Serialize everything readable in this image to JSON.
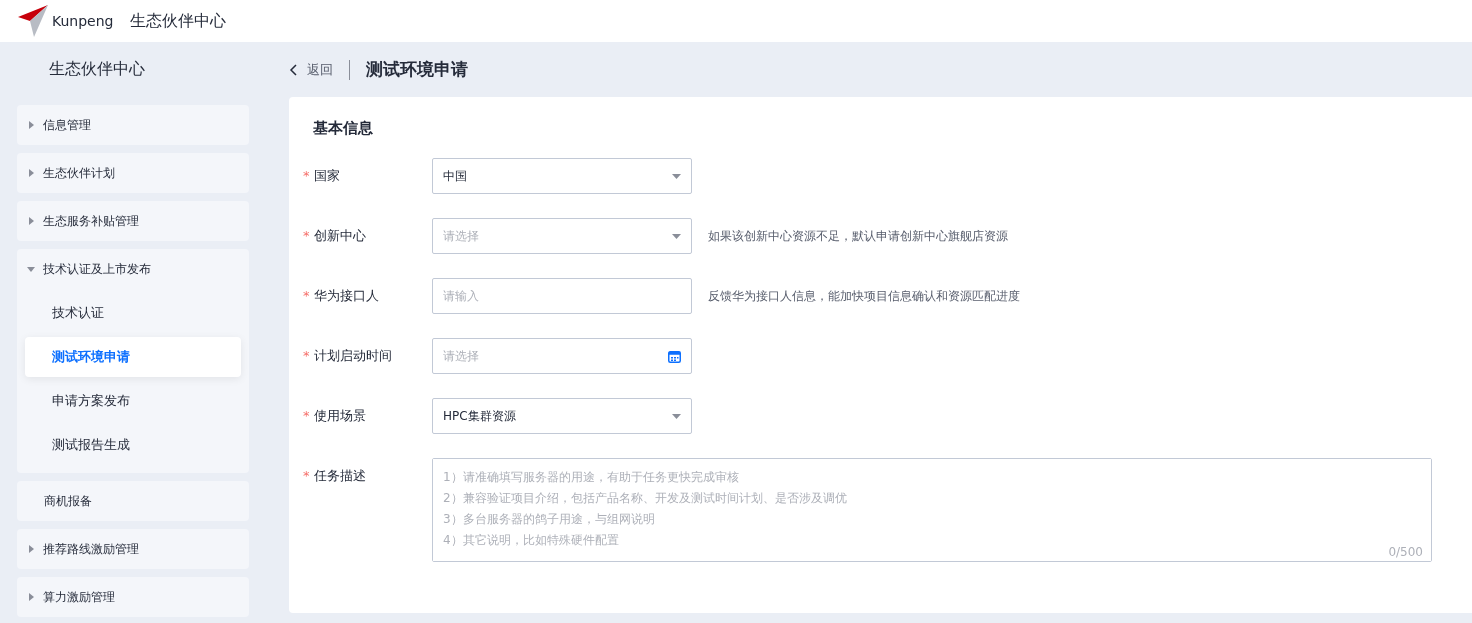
{
  "header": {
    "brand": "Kunpeng",
    "title": "生态伙伴中心"
  },
  "sidebar": {
    "title": "生态伙伴中心",
    "items": [
      {
        "kind": "group",
        "label": "信息管理",
        "expanded": false
      },
      {
        "kind": "group",
        "label": "生态伙伴计划",
        "expanded": false
      },
      {
        "kind": "group",
        "label": "生态服务补贴管理",
        "expanded": false
      },
      {
        "kind": "group",
        "label": "技术认证及上市发布",
        "expanded": true,
        "children": [
          {
            "label": "技术认证",
            "selected": false
          },
          {
            "label": "测试环境申请",
            "selected": true
          },
          {
            "label": "申请方案发布",
            "selected": false
          },
          {
            "label": "测试报告生成",
            "selected": false
          }
        ]
      },
      {
        "kind": "leaf",
        "label": "商机报备"
      },
      {
        "kind": "group",
        "label": "推荐路线激励管理",
        "expanded": false
      },
      {
        "kind": "group",
        "label": "算力激励管理",
        "expanded": false
      }
    ]
  },
  "breadcrumb": {
    "back": "返回",
    "title": "测试环境申请"
  },
  "form": {
    "section": "基本信息",
    "fields": [
      {
        "kind": "select",
        "label": "国家",
        "required_mark": "*",
        "value": "中国"
      },
      {
        "kind": "select",
        "label": "创新中心",
        "required_mark": "*",
        "placeholder": "请选择",
        "hint": "如果该创新中心资源不足，默认申请创新中心旗舰店资源"
      },
      {
        "kind": "input",
        "label": "华为接口人",
        "required_mark": "*",
        "placeholder": "请输入",
        "hint": "反馈华为接口人信息，能加快项目信息确认和资源匹配进度"
      },
      {
        "kind": "date",
        "label": "计划启动时间",
        "required_mark": "*",
        "placeholder": "请选择"
      },
      {
        "kind": "select",
        "label": "使用场景",
        "required_mark": "*",
        "value": "HPC集群资源"
      },
      {
        "kind": "textarea",
        "label": "任务描述",
        "required_mark": "*",
        "placeholder": "1）请准确填写服务器的用途，有助于任务更快完成审核\n2）兼容验证项目介绍，包括产品名称、开发及测试时间计划、是否涉及调优\n3）多台服务器的鸽子用途，与组网说明\n4）其它说明，比如特殊硬件配置",
        "counter": "0/500"
      }
    ]
  }
}
